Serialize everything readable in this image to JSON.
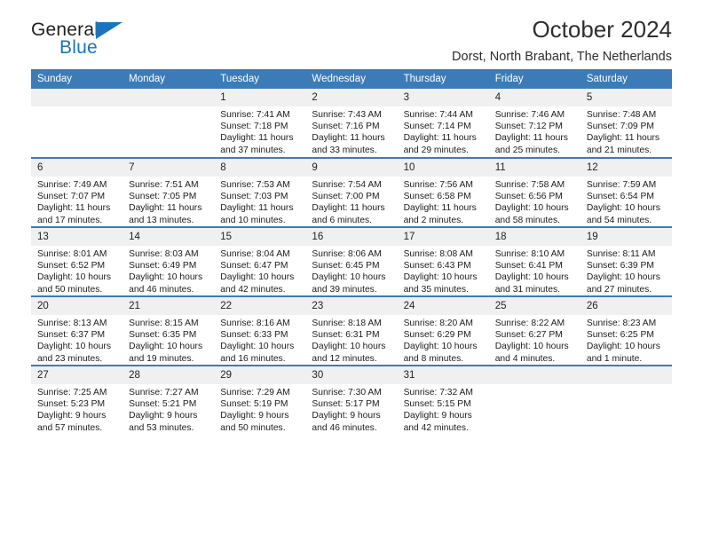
{
  "brand": {
    "name_part1": "General",
    "name_part2": "Blue",
    "triangle_color": "#1b74bb"
  },
  "header": {
    "title": "October 2024",
    "subtitle": "Dorst, North Brabant, The Netherlands",
    "accent_color": "#3b7cb8"
  },
  "weekdays": [
    "Sunday",
    "Monday",
    "Tuesday",
    "Wednesday",
    "Thursday",
    "Friday",
    "Saturday"
  ],
  "labels": {
    "sunrise": "Sunrise:",
    "sunset": "Sunset:",
    "daylight": "Daylight:"
  },
  "weeks": [
    [
      {
        "day": "",
        "empty": true
      },
      {
        "day": "",
        "empty": true
      },
      {
        "day": "1",
        "sunrise": "Sunrise: 7:41 AM",
        "sunset": "Sunset: 7:18 PM",
        "daylight": "Daylight: 11 hours and 37 minutes."
      },
      {
        "day": "2",
        "sunrise": "Sunrise: 7:43 AM",
        "sunset": "Sunset: 7:16 PM",
        "daylight": "Daylight: 11 hours and 33 minutes."
      },
      {
        "day": "3",
        "sunrise": "Sunrise: 7:44 AM",
        "sunset": "Sunset: 7:14 PM",
        "daylight": "Daylight: 11 hours and 29 minutes."
      },
      {
        "day": "4",
        "sunrise": "Sunrise: 7:46 AM",
        "sunset": "Sunset: 7:12 PM",
        "daylight": "Daylight: 11 hours and 25 minutes."
      },
      {
        "day": "5",
        "sunrise": "Sunrise: 7:48 AM",
        "sunset": "Sunset: 7:09 PM",
        "daylight": "Daylight: 11 hours and 21 minutes."
      }
    ],
    [
      {
        "day": "6",
        "sunrise": "Sunrise: 7:49 AM",
        "sunset": "Sunset: 7:07 PM",
        "daylight": "Daylight: 11 hours and 17 minutes."
      },
      {
        "day": "7",
        "sunrise": "Sunrise: 7:51 AM",
        "sunset": "Sunset: 7:05 PM",
        "daylight": "Daylight: 11 hours and 13 minutes."
      },
      {
        "day": "8",
        "sunrise": "Sunrise: 7:53 AM",
        "sunset": "Sunset: 7:03 PM",
        "daylight": "Daylight: 11 hours and 10 minutes."
      },
      {
        "day": "9",
        "sunrise": "Sunrise: 7:54 AM",
        "sunset": "Sunset: 7:00 PM",
        "daylight": "Daylight: 11 hours and 6 minutes."
      },
      {
        "day": "10",
        "sunrise": "Sunrise: 7:56 AM",
        "sunset": "Sunset: 6:58 PM",
        "daylight": "Daylight: 11 hours and 2 minutes."
      },
      {
        "day": "11",
        "sunrise": "Sunrise: 7:58 AM",
        "sunset": "Sunset: 6:56 PM",
        "daylight": "Daylight: 10 hours and 58 minutes."
      },
      {
        "day": "12",
        "sunrise": "Sunrise: 7:59 AM",
        "sunset": "Sunset: 6:54 PM",
        "daylight": "Daylight: 10 hours and 54 minutes."
      }
    ],
    [
      {
        "day": "13",
        "sunrise": "Sunrise: 8:01 AM",
        "sunset": "Sunset: 6:52 PM",
        "daylight": "Daylight: 10 hours and 50 minutes."
      },
      {
        "day": "14",
        "sunrise": "Sunrise: 8:03 AM",
        "sunset": "Sunset: 6:49 PM",
        "daylight": "Daylight: 10 hours and 46 minutes."
      },
      {
        "day": "15",
        "sunrise": "Sunrise: 8:04 AM",
        "sunset": "Sunset: 6:47 PM",
        "daylight": "Daylight: 10 hours and 42 minutes."
      },
      {
        "day": "16",
        "sunrise": "Sunrise: 8:06 AM",
        "sunset": "Sunset: 6:45 PM",
        "daylight": "Daylight: 10 hours and 39 minutes."
      },
      {
        "day": "17",
        "sunrise": "Sunrise: 8:08 AM",
        "sunset": "Sunset: 6:43 PM",
        "daylight": "Daylight: 10 hours and 35 minutes."
      },
      {
        "day": "18",
        "sunrise": "Sunrise: 8:10 AM",
        "sunset": "Sunset: 6:41 PM",
        "daylight": "Daylight: 10 hours and 31 minutes."
      },
      {
        "day": "19",
        "sunrise": "Sunrise: 8:11 AM",
        "sunset": "Sunset: 6:39 PM",
        "daylight": "Daylight: 10 hours and 27 minutes."
      }
    ],
    [
      {
        "day": "20",
        "sunrise": "Sunrise: 8:13 AM",
        "sunset": "Sunset: 6:37 PM",
        "daylight": "Daylight: 10 hours and 23 minutes."
      },
      {
        "day": "21",
        "sunrise": "Sunrise: 8:15 AM",
        "sunset": "Sunset: 6:35 PM",
        "daylight": "Daylight: 10 hours and 19 minutes."
      },
      {
        "day": "22",
        "sunrise": "Sunrise: 8:16 AM",
        "sunset": "Sunset: 6:33 PM",
        "daylight": "Daylight: 10 hours and 16 minutes."
      },
      {
        "day": "23",
        "sunrise": "Sunrise: 8:18 AM",
        "sunset": "Sunset: 6:31 PM",
        "daylight": "Daylight: 10 hours and 12 minutes."
      },
      {
        "day": "24",
        "sunrise": "Sunrise: 8:20 AM",
        "sunset": "Sunset: 6:29 PM",
        "daylight": "Daylight: 10 hours and 8 minutes."
      },
      {
        "day": "25",
        "sunrise": "Sunrise: 8:22 AM",
        "sunset": "Sunset: 6:27 PM",
        "daylight": "Daylight: 10 hours and 4 minutes."
      },
      {
        "day": "26",
        "sunrise": "Sunrise: 8:23 AM",
        "sunset": "Sunset: 6:25 PM",
        "daylight": "Daylight: 10 hours and 1 minute."
      }
    ],
    [
      {
        "day": "27",
        "sunrise": "Sunrise: 7:25 AM",
        "sunset": "Sunset: 5:23 PM",
        "daylight": "Daylight: 9 hours and 57 minutes."
      },
      {
        "day": "28",
        "sunrise": "Sunrise: 7:27 AM",
        "sunset": "Sunset: 5:21 PM",
        "daylight": "Daylight: 9 hours and 53 minutes."
      },
      {
        "day": "29",
        "sunrise": "Sunrise: 7:29 AM",
        "sunset": "Sunset: 5:19 PM",
        "daylight": "Daylight: 9 hours and 50 minutes."
      },
      {
        "day": "30",
        "sunrise": "Sunrise: 7:30 AM",
        "sunset": "Sunset: 5:17 PM",
        "daylight": "Daylight: 9 hours and 46 minutes."
      },
      {
        "day": "31",
        "sunrise": "Sunrise: 7:32 AM",
        "sunset": "Sunset: 5:15 PM",
        "daylight": "Daylight: 9 hours and 42 minutes."
      },
      {
        "day": "",
        "empty": true
      },
      {
        "day": "",
        "empty": true
      }
    ]
  ]
}
